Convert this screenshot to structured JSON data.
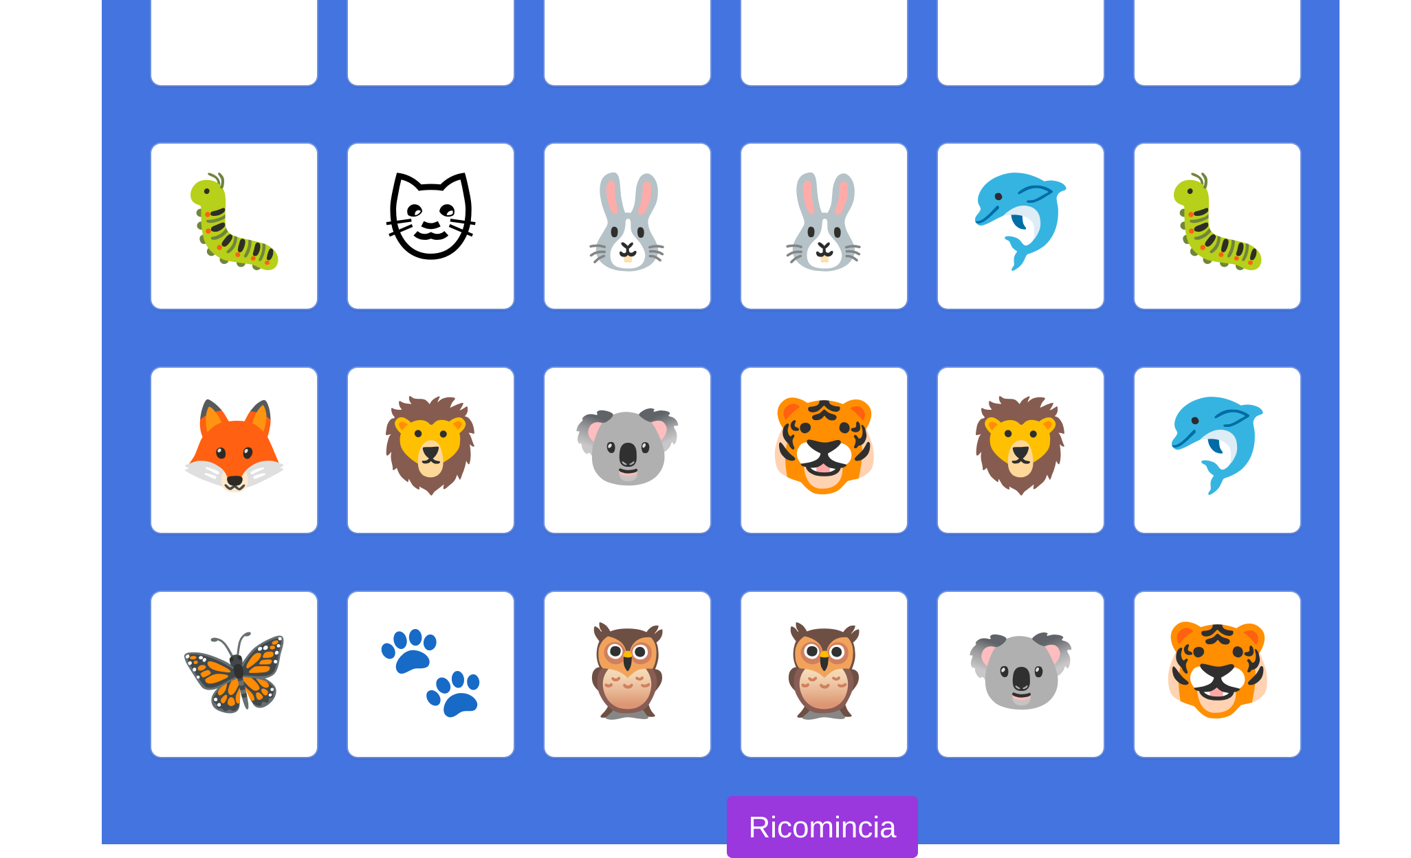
{
  "cards": [
    {
      "icon": "fox-icon",
      "emoji": "🦊"
    },
    {
      "icon": "paw-prints-icon",
      "emoji": "🐾"
    },
    {
      "icon": "cat-icon",
      "emoji": "🐱"
    },
    {
      "icon": "bee-icon",
      "emoji": "🐝"
    },
    {
      "icon": "butterfly-icon",
      "emoji": "🦋"
    },
    {
      "icon": "bee-icon",
      "emoji": "🐝"
    },
    {
      "icon": "caterpillar-icon",
      "emoji": "🐛"
    },
    {
      "icon": "cat-icon",
      "emoji": "🐱"
    },
    {
      "icon": "rabbit-icon",
      "emoji": "🐰"
    },
    {
      "icon": "rabbit-icon",
      "emoji": "🐰"
    },
    {
      "icon": "dolphin-icon",
      "emoji": "🐬"
    },
    {
      "icon": "caterpillar-icon",
      "emoji": "🐛"
    },
    {
      "icon": "fox-icon",
      "emoji": "🦊"
    },
    {
      "icon": "lion-icon",
      "emoji": "🦁"
    },
    {
      "icon": "koala-icon",
      "emoji": "🐨"
    },
    {
      "icon": "tiger-icon",
      "emoji": "🐯"
    },
    {
      "icon": "lion-icon",
      "emoji": "🦁"
    },
    {
      "icon": "dolphin-icon",
      "emoji": "🐬"
    },
    {
      "icon": "butterfly-icon",
      "emoji": "🦋"
    },
    {
      "icon": "paw-prints-icon",
      "emoji": "🐾"
    },
    {
      "icon": "owl-icon",
      "emoji": "🦉"
    },
    {
      "icon": "owl-icon",
      "emoji": "🦉"
    },
    {
      "icon": "koala-icon",
      "emoji": "🐨"
    },
    {
      "icon": "tiger-icon",
      "emoji": "🐯"
    }
  ],
  "restart_label": "Ricomincia",
  "colors": {
    "board_background": "#4374e0",
    "card_background": "#ffffff",
    "button_background": "#9a37dd",
    "button_text": "#ffffff"
  }
}
